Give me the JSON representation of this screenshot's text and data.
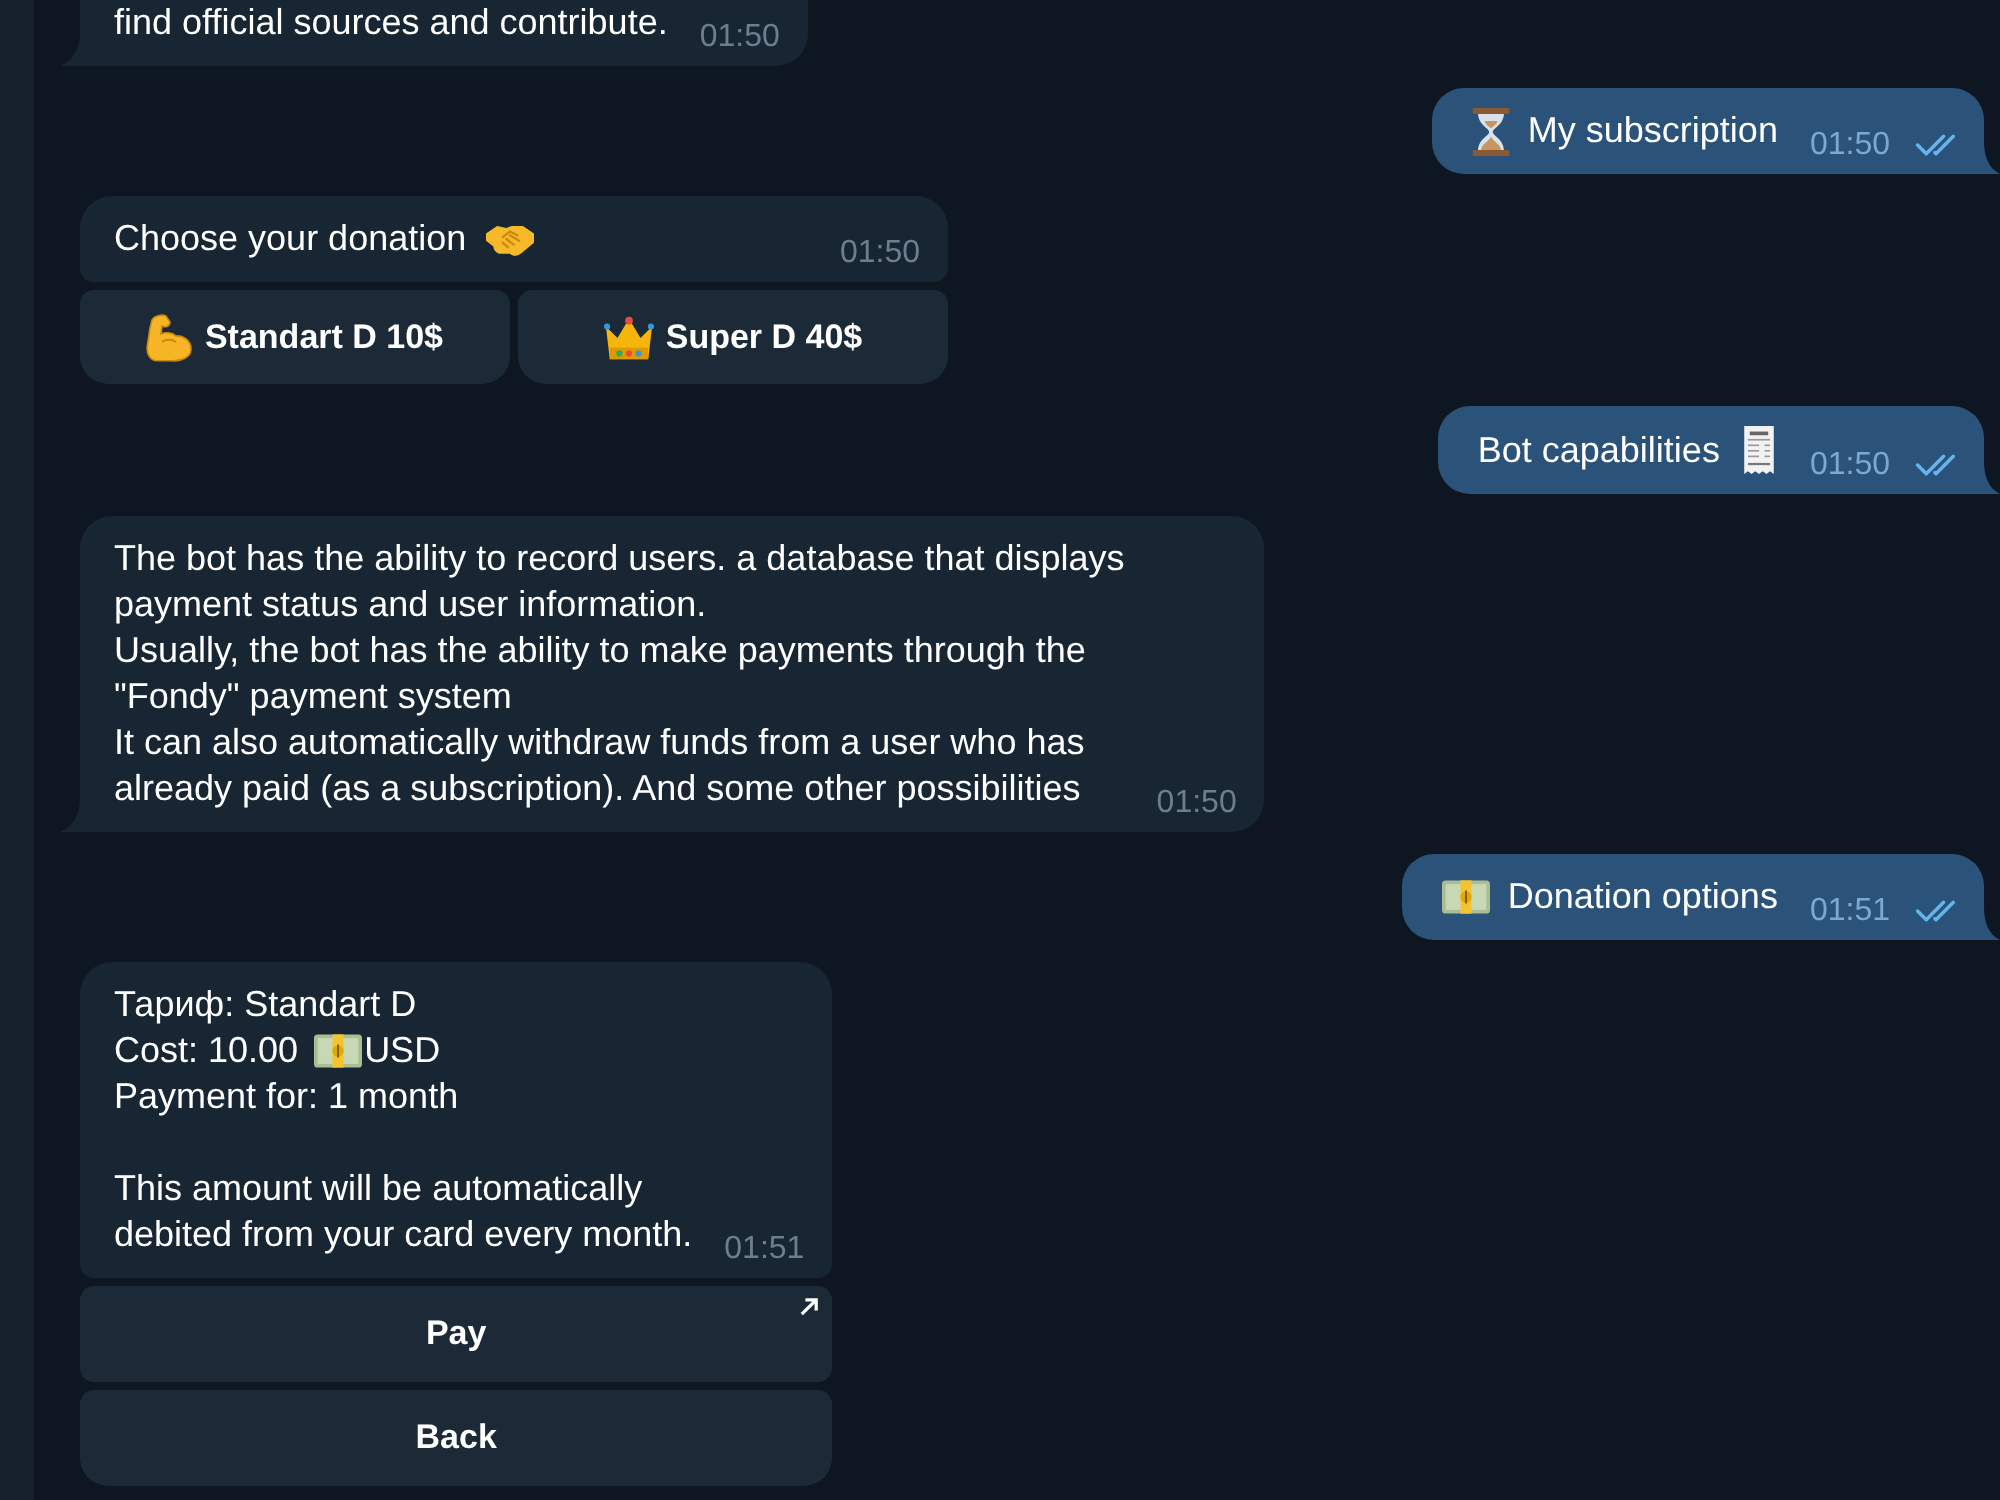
{
  "messages": [
    {
      "kind": "incoming",
      "text": "find official sources and contribute.",
      "time": "01:50"
    },
    {
      "kind": "outgoing",
      "text": "My subscription",
      "time": "01:50",
      "read": true
    },
    {
      "kind": "incoming",
      "text": "Choose your donation",
      "time": "01:50",
      "keyboard": [
        [
          {
            "label": "Standart D 10$",
            "external": false
          },
          {
            "label": "Super D 40$",
            "external": false
          }
        ]
      ]
    },
    {
      "kind": "outgoing",
      "text": "Bot capabilities",
      "time": "01:50",
      "read": true
    },
    {
      "kind": "incoming",
      "text": "The bot has the ability to record users. a database that displays\npayment status and user information.\nUsually, the bot has the ability to make payments through the\n\"Fondy\" payment system\nIt can also automatically withdraw funds from a user who has\nalready paid (as a subscription). And some other possibilities",
      "time": "01:50"
    },
    {
      "kind": "outgoing",
      "text": "Donation options",
      "time": "01:51",
      "read": true
    },
    {
      "kind": "invoice",
      "tariff": "Тариф: Standart D",
      "cost": "Cost: 10.00",
      "currency": "USD",
      "period": "Payment for: 1 month",
      "note": "This amount will be automatically\ndebited from your card every month.",
      "time": "01:51",
      "keyboard": [
        [
          {
            "label": "Pay",
            "external": true
          }
        ],
        [
          {
            "label": "Back",
            "external": false
          }
        ]
      ]
    }
  ]
}
